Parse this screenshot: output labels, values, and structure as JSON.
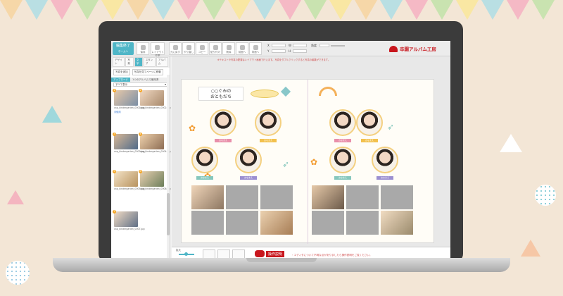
{
  "toolbar": {
    "edit_done_label": "編集終了",
    "edit_done_sub": "ホームへ",
    "buttons": [
      "保存",
      "レイアウト変更",
      "元に戻す",
      "やり直し",
      "コピー",
      "貼り付け",
      "削除",
      "前面へ",
      "背面へ",
      "画像",
      "テキスト"
    ],
    "angle_label": "角度"
  },
  "brand": {
    "name": "卒園アルバム工房",
    "color": "#c8161d"
  },
  "panel": {
    "tabs": [
      "デザイン",
      "写真",
      "文字",
      "スタンプ",
      "アルバム"
    ],
    "active_tab": "文字",
    "btn_add_photo": "写真を追加",
    "btn_change": "写真を見てページに移動",
    "folder_tab": "アップロード",
    "folder_tab2": "1つのアルバムで使用済",
    "select_value": "すべて表示",
    "files": [
      {
        "n": "1",
        "name": "cap_kindergarten_0001.jpg",
        "used": "未使用"
      },
      {
        "n": "2",
        "name": "cap_kindergarten_0002.jpg",
        "used": "未使用"
      },
      {
        "n": "3",
        "name": "cap_kindergarten_0003.jpg",
        "used": "未使用"
      },
      {
        "n": "4",
        "name": "cap_kindergarten_0004.jpg",
        "used": "未使用"
      },
      {
        "n": "5",
        "name": "cap_kindergarten_0005.jpg",
        "used": "未使用"
      },
      {
        "n": "6",
        "name": "cap_kindergarten_0006.jpg",
        "used": "未使用"
      },
      {
        "n": "7",
        "name": "cap_kindergarten_0007.jpg",
        "used": "未使用"
      }
    ]
  },
  "canvas": {
    "hint": "※テキストや写真の配置はレイアウト画面で行えます。写真をダブルクリックすると写真の編集ができます。",
    "title_line1": "○○ぐみの",
    "title_line2": "おともだち",
    "name_label": "おなまえ"
  },
  "footer": {
    "zoom_label": "拡大",
    "btn_view": "見開き",
    "btn_page": "ページ",
    "btn_preview": "プレビュー",
    "help_label": "操作説明",
    "help_note": "・エディタについて不明な点がありましたら操作説明をご覧ください。"
  }
}
